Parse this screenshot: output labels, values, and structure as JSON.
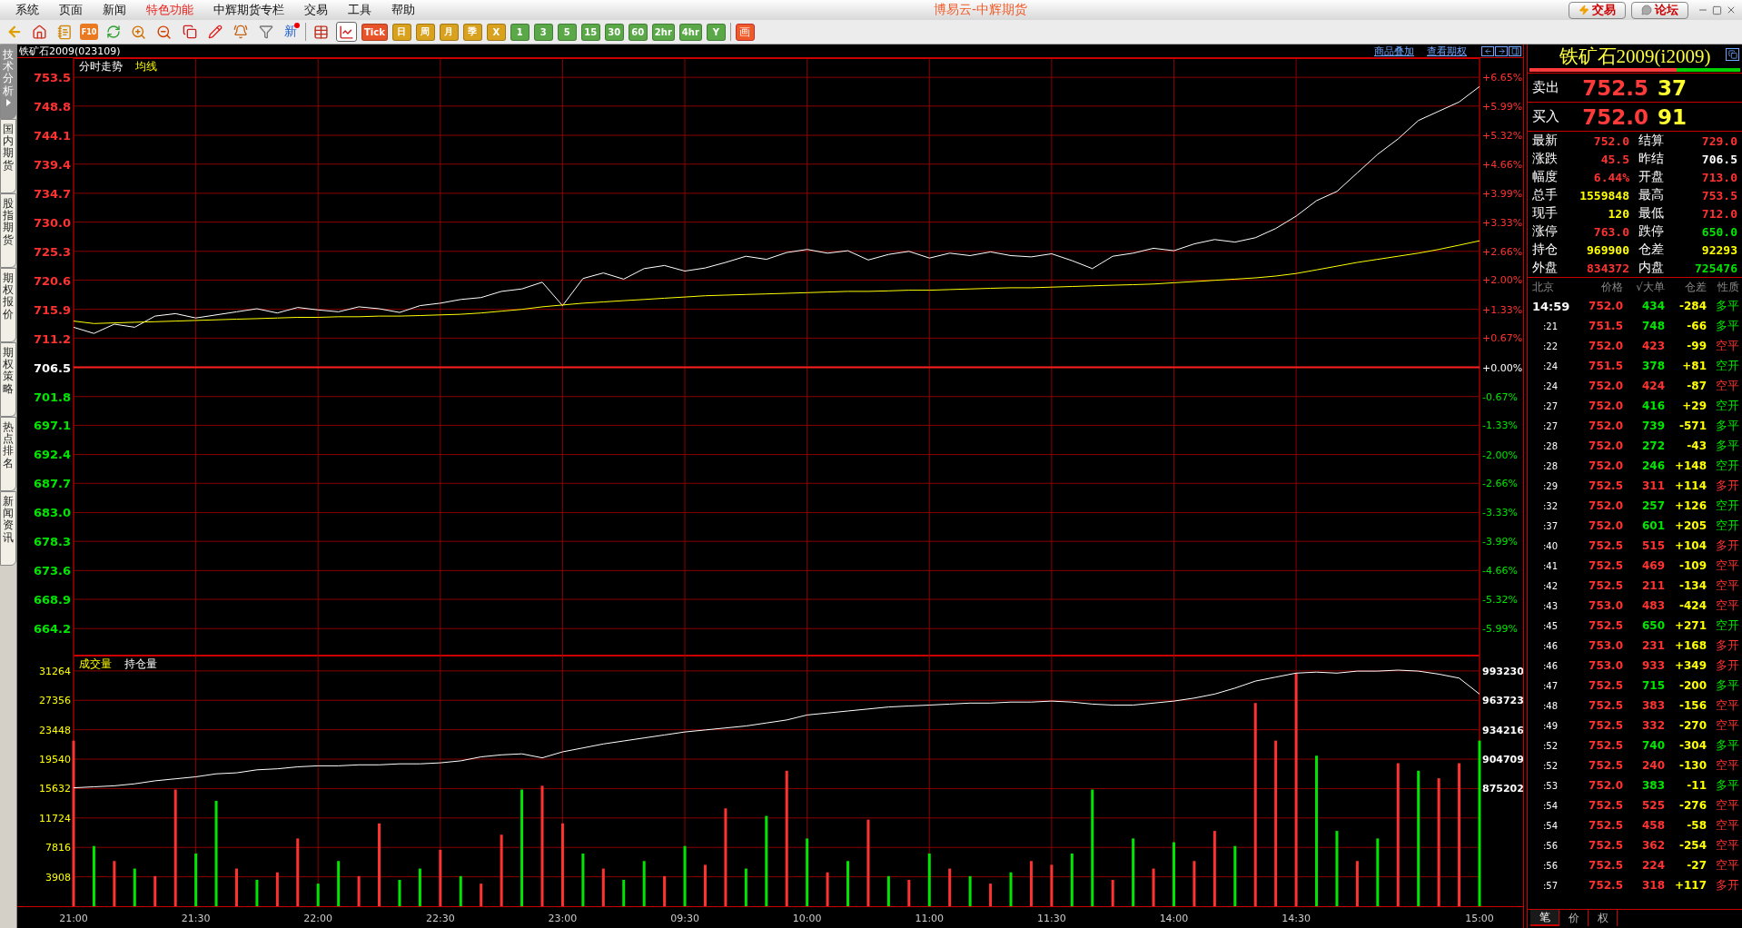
{
  "menu": {
    "items": [
      {
        "label": "系统",
        "selected": false
      },
      {
        "label": "页面",
        "selected": false
      },
      {
        "label": "新闻",
        "selected": false
      },
      {
        "label": "特色功能",
        "selected": true
      },
      {
        "label": "中辉期货专栏",
        "selected": false
      },
      {
        "label": "交易",
        "selected": false
      },
      {
        "label": "工具",
        "selected": false
      },
      {
        "label": "帮助",
        "selected": false
      }
    ],
    "title": "博易云-中辉期货",
    "trade_button": "交易",
    "forum_button": "论坛"
  },
  "toolbar": {
    "f10_label": "F10",
    "new_label": "新",
    "views": [
      {
        "selected": false
      },
      {
        "selected": true
      }
    ],
    "periods": [
      {
        "label": "Tick",
        "kind": "tick"
      },
      {
        "label": "日",
        "kind": "day"
      },
      {
        "label": "周",
        "kind": "day"
      },
      {
        "label": "月",
        "kind": "day"
      },
      {
        "label": "季",
        "kind": "day"
      },
      {
        "label": "X",
        "kind": "day"
      },
      {
        "label": "1",
        "kind": "minute"
      },
      {
        "label": "3",
        "kind": "minute"
      },
      {
        "label": "5",
        "kind": "minute"
      },
      {
        "label": "15",
        "kind": "minute"
      },
      {
        "label": "30",
        "kind": "minute"
      },
      {
        "label": "60",
        "kind": "minute"
      },
      {
        "label": "2hr",
        "kind": "minute"
      },
      {
        "label": "4hr",
        "kind": "minute"
      },
      {
        "label": "Y",
        "kind": "minute"
      }
    ],
    "draw_label": "画"
  },
  "side_tabs": [
    {
      "label": "技术分析",
      "selected": true
    },
    {
      "label": "国内期货",
      "selected": false
    },
    {
      "label": "股指期货",
      "selected": false
    },
    {
      "label": "期权报价",
      "selected": false
    },
    {
      "label": "期权策略",
      "selected": false
    },
    {
      "label": "热点排名",
      "selected": false
    },
    {
      "label": "新闻资讯",
      "selected": false
    }
  ],
  "chart_header": {
    "symbol": "铁矿石2009(023109)",
    "links": [
      "商品叠加",
      "查看期权"
    ]
  },
  "price_chart": {
    "chart_data": {
      "type": "line",
      "grid": true,
      "ylim": [
        659.8,
        756.6
      ],
      "y2lim": [
        -6.61,
        7.09
      ],
      "ref_lines": [
        {
          "axis": "y2",
          "value": 0
        }
      ],
      "yticks": [
        {
          "value": 753.5,
          "label": "753.5"
        },
        {
          "value": 748.8,
          "label": "748.8"
        },
        {
          "value": 744.1,
          "label": "744.1"
        },
        {
          "value": 739.4,
          "label": "739.4"
        },
        {
          "value": 734.7,
          "label": "734.7"
        },
        {
          "value": 730.0,
          "label": "730.0"
        },
        {
          "value": 725.3,
          "label": "725.3"
        },
        {
          "value": 720.6,
          "label": "720.6"
        },
        {
          "value": 715.9,
          "label": "715.9"
        },
        {
          "value": 711.2,
          "label": "711.2"
        },
        {
          "value": 706.5,
          "label": "706.5"
        },
        {
          "value": 701.8,
          "label": "701.8"
        },
        {
          "value": 697.1,
          "label": "697.1"
        },
        {
          "value": 692.4,
          "label": "692.4"
        },
        {
          "value": 687.7,
          "label": "687.7"
        },
        {
          "value": 683.0,
          "label": "683.0"
        },
        {
          "value": 678.3,
          "label": "678.3"
        },
        {
          "value": 673.6,
          "label": "673.6"
        },
        {
          "value": 668.9,
          "label": "668.9"
        },
        {
          "value": 664.2,
          "label": "664.2"
        }
      ],
      "y2ticks": [
        {
          "value": 6.65,
          "label": "+6.65%"
        },
        {
          "value": 5.99,
          "label": "+5.99%"
        },
        {
          "value": 5.32,
          "label": "+5.32%"
        },
        {
          "value": 4.66,
          "label": "+4.66%"
        },
        {
          "value": 3.99,
          "label": "+3.99%"
        },
        {
          "value": 3.33,
          "label": "+3.33%"
        },
        {
          "value": 2.66,
          "label": "+2.66%"
        },
        {
          "value": 2.0,
          "label": "+2.00%"
        },
        {
          "value": 1.33,
          "label": "+1.33%"
        },
        {
          "value": 0.67,
          "label": "+0.67%"
        },
        {
          "value": 0,
          "label": "+0.00%"
        },
        {
          "value": -0.67,
          "label": "-0.67%"
        },
        {
          "value": -1.33,
          "label": "-1.33%"
        },
        {
          "value": -2.0,
          "label": "-2.00%"
        },
        {
          "value": -2.66,
          "label": "-2.66%"
        },
        {
          "value": -3.33,
          "label": "-3.33%"
        },
        {
          "value": -3.99,
          "label": "-3.99%"
        },
        {
          "value": -4.66,
          "label": "-4.66%"
        },
        {
          "value": -5.32,
          "label": "-5.32%"
        },
        {
          "value": -5.99,
          "label": "-5.99%"
        }
      ],
      "series": [
        {
          "name": "分时走势",
          "color": "#ffffff",
          "values": [
            713.0,
            712.0,
            713.5,
            713.0,
            714.8,
            715.2,
            714.5,
            715.0,
            715.5,
            716.0,
            715.3,
            716.2,
            715.8,
            715.5,
            716.3,
            716.0,
            715.4,
            716.5,
            716.9,
            717.5,
            717.8,
            718.8,
            719.2,
            720.3,
            716.5,
            720.9,
            721.8,
            720.8,
            722.5,
            723.0,
            722.1,
            722.6,
            723.5,
            724.5,
            724.0,
            725.1,
            725.6,
            725.0,
            725.4,
            723.9,
            724.8,
            725.3,
            724.2,
            725.0,
            724.6,
            725.2,
            724.6,
            724.4,
            724.9,
            723.8,
            722.5,
            724.5,
            725.0,
            725.8,
            725.4,
            726.5,
            727.2,
            726.8,
            727.5,
            729.0,
            731.0,
            733.5,
            735.0,
            738.0,
            741.0,
            743.5,
            746.5,
            748.0,
            749.5,
            752.0
          ]
        },
        {
          "name": "均线",
          "color": "#ffff00",
          "values": [
            714.0,
            713.6,
            713.7,
            713.8,
            713.9,
            714.0,
            714.1,
            714.2,
            714.3,
            714.4,
            714.5,
            714.6,
            714.6,
            714.7,
            714.7,
            714.8,
            714.8,
            714.9,
            715.0,
            715.1,
            715.3,
            715.6,
            715.9,
            716.3,
            716.6,
            716.9,
            717.1,
            717.3,
            717.5,
            717.7,
            717.9,
            718.1,
            718.2,
            718.3,
            718.4,
            718.5,
            718.6,
            718.7,
            718.8,
            718.8,
            718.9,
            719.0,
            719.0,
            719.1,
            719.2,
            719.3,
            719.4,
            719.4,
            719.5,
            719.6,
            719.7,
            719.8,
            719.9,
            720.0,
            720.2,
            720.4,
            720.6,
            720.8,
            721.0,
            721.3,
            721.7,
            722.3,
            722.9,
            723.5,
            724.0,
            724.5,
            725.0,
            725.6,
            726.3,
            727.0
          ]
        }
      ]
    }
  },
  "volume_chart": {
    "chart_data": {
      "type": "bar",
      "title": "成交量",
      "grid": true,
      "stacked": true,
      "ylim": [
        0,
        33300
      ],
      "y2lim": [
        757174,
        1008603
      ],
      "yticks": [
        {
          "value": 31264,
          "label": "31264"
        },
        {
          "value": 27356,
          "label": "27356"
        },
        {
          "value": 23448,
          "label": "23448"
        },
        {
          "value": 19540,
          "label": "19540"
        },
        {
          "value": 15632,
          "label": "15632"
        },
        {
          "value": 11724,
          "label": "11724"
        },
        {
          "value": 7816,
          "label": "7816"
        },
        {
          "value": 3908,
          "label": "3908"
        }
      ],
      "y2ticks": [
        {
          "value": 993230,
          "label": "993230"
        },
        {
          "value": 963723,
          "label": "963723"
        },
        {
          "value": 934216,
          "label": "934216"
        },
        {
          "value": 904709,
          "label": "904709"
        },
        {
          "value": 875202,
          "label": "875202"
        }
      ],
      "categories": [
        "21:00",
        null,
        null,
        null,
        null,
        null,
        "21:30",
        null,
        null,
        null,
        null,
        null,
        "22:00",
        null,
        null,
        null,
        null,
        null,
        "22:30",
        null,
        null,
        null,
        null,
        null,
        "23:00",
        null,
        null,
        null,
        null,
        null,
        "09:30",
        null,
        null,
        null,
        null,
        null,
        "10:00",
        null,
        null,
        null,
        null,
        null,
        "11:00",
        null,
        null,
        null,
        null,
        null,
        "11:30",
        null,
        null,
        null,
        null,
        null,
        "14:00",
        null,
        null,
        null,
        null,
        null,
        "14:30",
        null,
        null,
        null,
        null,
        null,
        null,
        null,
        null,
        "15:00"
      ],
      "series": [
        {
          "color": "#ff3232",
          "values": [
            22000,
            null,
            6000,
            null,
            4000,
            15500,
            null,
            null,
            5000,
            null,
            4500,
            9000,
            null,
            null,
            4000,
            11000,
            null,
            null,
            7500,
            null,
            3000,
            9500,
            null,
            16000,
            11000,
            null,
            5000,
            null,
            null,
            4000,
            null,
            5500,
            13000,
            null,
            null,
            18000,
            null,
            4500,
            null,
            11500,
            null,
            3500,
            null,
            5000,
            null,
            3000,
            null,
            6000,
            5500,
            null,
            null,
            3500,
            null,
            5000,
            null,
            6000,
            10000,
            null,
            27000,
            22000,
            31000,
            null,
            null,
            6000,
            null,
            19000,
            null,
            17000,
            19000,
            null
          ]
        },
        {
          "color": "#00e600",
          "values": [
            null,
            8000,
            null,
            5000,
            null,
            null,
            7000,
            14000,
            null,
            3500,
            null,
            null,
            3000,
            6000,
            null,
            null,
            3500,
            5000,
            null,
            4000,
            null,
            null,
            15500,
            null,
            null,
            7000,
            null,
            3500,
            6000,
            null,
            8000,
            null,
            null,
            5000,
            12000,
            null,
            9000,
            null,
            6000,
            null,
            4000,
            null,
            7000,
            null,
            4000,
            null,
            4500,
            null,
            null,
            7000,
            15500,
            null,
            9000,
            null,
            8500,
            null,
            null,
            8000,
            null,
            null,
            null,
            20000,
            10000,
            null,
            9000,
            null,
            18000,
            null,
            null,
            22000
          ]
        },
        {
          "name": "持仓量",
          "type": "line",
          "color": "#ffffff",
          "axis": "y2",
          "values": [
            876000,
            877000,
            878000,
            880000,
            883000,
            885000,
            887000,
            890000,
            891000,
            894000,
            895000,
            897000,
            898000,
            898000,
            899000,
            899000,
            900000,
            900000,
            901000,
            903000,
            907000,
            909000,
            910000,
            906000,
            912000,
            916000,
            920000,
            923000,
            926000,
            929000,
            932000,
            934000,
            936000,
            938000,
            941000,
            944000,
            949000,
            951000,
            953000,
            955000,
            957000,
            958000,
            959000,
            960000,
            961000,
            961000,
            962000,
            962000,
            963000,
            962000,
            960000,
            959000,
            959000,
            961000,
            963000,
            966000,
            970000,
            976000,
            983000,
            987000,
            991000,
            992000,
            991000,
            993000,
            993000,
            994000,
            993000,
            990000,
            986000,
            970000
          ]
        }
      ]
    }
  },
  "quote_panel": {
    "title": "铁矿石2009(i2009)",
    "ratio_bar": {
      "level": 0.7
    },
    "ask": {
      "label": "卖出",
      "price": "752.5",
      "volume": "37"
    },
    "bid": {
      "label": "买入",
      "price": "752.0",
      "volume": "91"
    },
    "stats": [
      {
        "label": "最新",
        "value": "752.0",
        "color": "#ff3232"
      },
      {
        "label": "结算",
        "value": "729.0",
        "color": "#ff3232"
      },
      {
        "label": "涨跌",
        "value": "45.5",
        "color": "#ff3232"
      },
      {
        "label": "昨结",
        "value": "706.5",
        "color": "#ffffff"
      },
      {
        "label": "幅度",
        "value": "6.44%",
        "color": "#ff3232"
      },
      {
        "label": "开盘",
        "value": "713.0",
        "color": "#ff3232"
      },
      {
        "label": "总手",
        "value": "1559848",
        "color": "#ffff00"
      },
      {
        "label": "最高",
        "value": "753.5",
        "color": "#ff3232"
      },
      {
        "label": "现手",
        "value": "120",
        "color": "#ffff00"
      },
      {
        "label": "最低",
        "value": "712.0",
        "color": "#ff3232"
      },
      {
        "label": "涨停",
        "value": "763.0",
        "color": "#ff3232"
      },
      {
        "label": "跌停",
        "value": "650.0",
        "color": "#00e600"
      },
      {
        "label": "持仓",
        "value": "969900",
        "color": "#ffff00"
      },
      {
        "label": "仓差",
        "value": "92293",
        "color": "#ffff00"
      },
      {
        "label": "外盘",
        "value": "834372",
        "color": "#ff3232"
      },
      {
        "label": "内盘",
        "value": "725476",
        "color": "#00e600"
      }
    ],
    "ticks_header": [
      "北京",
      "价格",
      "√大单",
      "仓差",
      "性质"
    ],
    "ticks": [
      {
        "time": "14:59",
        "price": "752.0",
        "volume": "434",
        "change": "-284",
        "type": "多平",
        "color": "#00e600"
      },
      {
        "time": ":21",
        "price": "751.5",
        "volume": "748",
        "change": "-66",
        "type": "多平",
        "color": "#00e600"
      },
      {
        "time": ":22",
        "price": "752.0",
        "volume": "423",
        "change": "-99",
        "type": "空平",
        "color": "#ff3232"
      },
      {
        "time": ":24",
        "price": "751.5",
        "volume": "378",
        "change": "+81",
        "type": "空开",
        "color": "#00e600"
      },
      {
        "time": ":24",
        "price": "752.0",
        "volume": "424",
        "change": "-87",
        "type": "空平",
        "color": "#ff3232"
      },
      {
        "time": ":27",
        "price": "752.0",
        "volume": "416",
        "change": "+29",
        "type": "空开",
        "color": "#00e600"
      },
      {
        "time": ":27",
        "price": "752.0",
        "volume": "739",
        "change": "-571",
        "type": "多平",
        "color": "#00e600"
      },
      {
        "time": ":28",
        "price": "752.0",
        "volume": "272",
        "change": "-43",
        "type": "多平",
        "color": "#00e600"
      },
      {
        "time": ":28",
        "price": "752.0",
        "volume": "246",
        "change": "+148",
        "type": "空开",
        "color": "#00e600"
      },
      {
        "time": ":29",
        "price": "752.5",
        "volume": "311",
        "change": "+114",
        "type": "多开",
        "color": "#ff3232"
      },
      {
        "time": ":32",
        "price": "752.0",
        "volume": "257",
        "change": "+126",
        "type": "空开",
        "color": "#00e600"
      },
      {
        "time": ":37",
        "price": "752.0",
        "volume": "601",
        "change": "+205",
        "type": "空开",
        "color": "#00e600"
      },
      {
        "time": ":40",
        "price": "752.5",
        "volume": "515",
        "change": "+104",
        "type": "多开",
        "color": "#ff3232"
      },
      {
        "time": ":41",
        "price": "752.5",
        "volume": "469",
        "change": "-109",
        "type": "空平",
        "color": "#ff3232"
      },
      {
        "time": ":42",
        "price": "752.5",
        "volume": "211",
        "change": "-134",
        "type": "空平",
        "color": "#ff3232"
      },
      {
        "time": ":43",
        "price": "753.0",
        "volume": "483",
        "change": "-424",
        "type": "空平",
        "color": "#ff3232"
      },
      {
        "time": ":45",
        "price": "752.5",
        "volume": "650",
        "change": "+271",
        "type": "空开",
        "color": "#00e600"
      },
      {
        "time": ":46",
        "price": "753.0",
        "volume": "231",
        "change": "+168",
        "type": "多开",
        "color": "#ff3232"
      },
      {
        "time": ":46",
        "price": "753.0",
        "volume": "933",
        "change": "+349",
        "type": "多开",
        "color": "#ff3232"
      },
      {
        "time": ":47",
        "price": "752.5",
        "volume": "715",
        "change": "-200",
        "type": "多平",
        "color": "#00e600"
      },
      {
        "time": ":48",
        "price": "752.5",
        "volume": "383",
        "change": "-156",
        "type": "空平",
        "color": "#ff3232"
      },
      {
        "time": ":49",
        "price": "752.5",
        "volume": "332",
        "change": "-270",
        "type": "空平",
        "color": "#ff3232"
      },
      {
        "time": ":52",
        "price": "752.5",
        "volume": "740",
        "change": "-304",
        "type": "多平",
        "color": "#00e600"
      },
      {
        "time": ":52",
        "price": "752.5",
        "volume": "240",
        "change": "-130",
        "type": "空平",
        "color": "#ff3232"
      },
      {
        "time": ":53",
        "price": "752.0",
        "volume": "383",
        "change": "-11",
        "type": "多平",
        "color": "#00e600"
      },
      {
        "time": ":54",
        "price": "752.5",
        "volume": "525",
        "change": "-276",
        "type": "空平",
        "color": "#ff3232"
      },
      {
        "time": ":54",
        "price": "752.5",
        "volume": "458",
        "change": "-58",
        "type": "空平",
        "color": "#ff3232"
      },
      {
        "time": ":56",
        "price": "752.5",
        "volume": "362",
        "change": "-254",
        "type": "空平",
        "color": "#ff3232"
      },
      {
        "time": ":56",
        "price": "752.5",
        "volume": "224",
        "change": "-27",
        "type": "空平",
        "color": "#ff3232"
      },
      {
        "time": ":57",
        "price": "752.5",
        "volume": "318",
        "change": "+117",
        "type": "多开",
        "color": "#ff3232"
      }
    ],
    "bottom_tabs": [
      {
        "label": "笔",
        "selected": true
      },
      {
        "label": "价",
        "selected": false
      },
      {
        "label": "权",
        "selected": false
      }
    ]
  }
}
